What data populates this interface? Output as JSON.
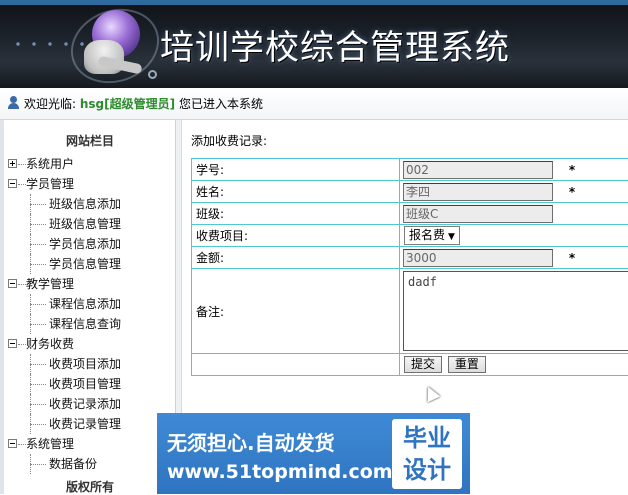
{
  "app": {
    "title": "培训学校综合管理系统"
  },
  "welcome": {
    "prefix": "欢迎光临:",
    "user": "hsg[超级管理员]",
    "suffix": " 您已进入本系统"
  },
  "sidebar": {
    "title": "网站栏目",
    "groups": [
      {
        "label": "系统用户",
        "expanded": false,
        "items": []
      },
      {
        "label": "学员管理",
        "expanded": true,
        "items": [
          "班级信息添加",
          "班级信息管理",
          "学员信息添加",
          "学员信息管理"
        ]
      },
      {
        "label": "教学管理",
        "expanded": true,
        "items": [
          "课程信息添加",
          "课程信息查询"
        ]
      },
      {
        "label": "财务收费",
        "expanded": true,
        "items": [
          "收费项目添加",
          "收费项目管理",
          "收费记录添加",
          "收费记录管理"
        ]
      },
      {
        "label": "系统管理",
        "expanded": true,
        "items": [
          "数据备份"
        ]
      }
    ],
    "copyright": "版权所有"
  },
  "form": {
    "heading": "添加收费记录:",
    "fields": {
      "student_id": {
        "label": "学号:",
        "value": "002",
        "required": "*"
      },
      "name": {
        "label": "姓名:",
        "value": "李四",
        "required": "*"
      },
      "class": {
        "label": "班级:",
        "value": "班级C"
      },
      "fee_item": {
        "label": "收费项目:",
        "value": "报名费"
      },
      "amount": {
        "label": "金额:",
        "value": "3000",
        "required": "*"
      },
      "remark": {
        "label": "备注:",
        "value": "dadf"
      }
    },
    "buttons": {
      "submit": "提交",
      "reset": "重置"
    }
  },
  "ad": {
    "line1": "无须担心.自动发货",
    "line2": "www.51topmind.com",
    "badge_top": "毕业",
    "badge_bottom": "设计"
  }
}
